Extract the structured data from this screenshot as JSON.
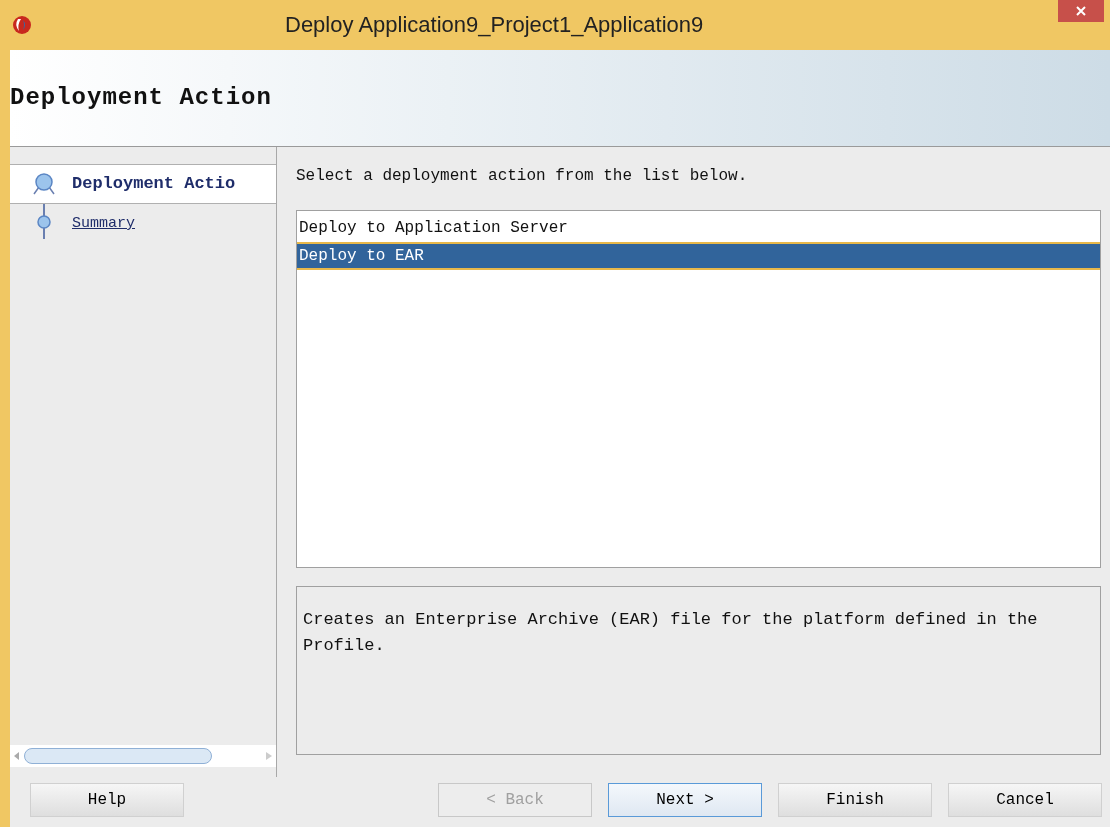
{
  "window": {
    "title": "Deploy Application9_Project1_Application9"
  },
  "header": {
    "title": "Deployment Action"
  },
  "steps": [
    {
      "label": "Deployment Actio",
      "selected": true
    },
    {
      "label": "Summary",
      "selected": false
    }
  ],
  "prompt": {
    "text": "Select a deployment action from the list below."
  },
  "actions": [
    {
      "label": "Deploy to Application Server",
      "selected": false
    },
    {
      "label": "Deploy to EAR",
      "selected": true
    }
  ],
  "description": "Creates an Enterprise Archive (EAR) file for the platform defined in the Profile.",
  "buttons": [
    {
      "label": "Help",
      "disabled": false,
      "default": false
    },
    {
      "label": "< Back",
      "disabled": true,
      "default": false
    },
    {
      "label": "Next >",
      "disabled": false,
      "default": true
    },
    {
      "label": "Finish",
      "disabled": false,
      "default": false
    },
    {
      "label": "Cancel",
      "disabled": false,
      "default": false
    }
  ]
}
